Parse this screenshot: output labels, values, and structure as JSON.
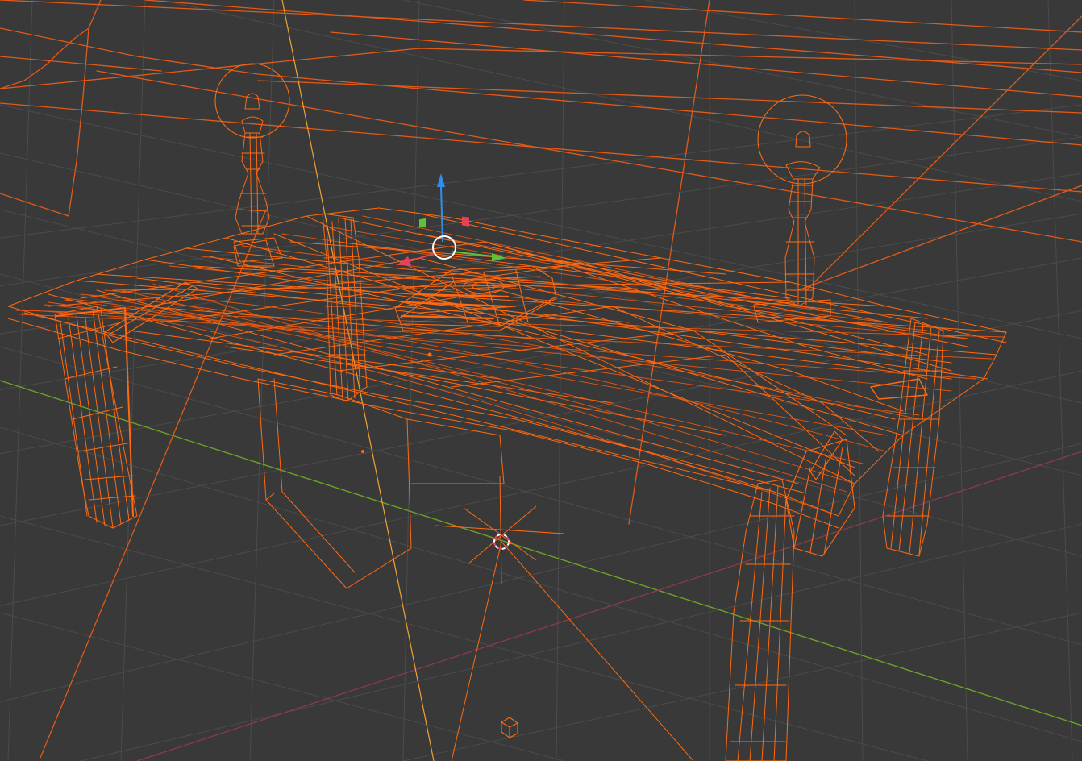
{
  "viewport": {
    "mode": "wireframe",
    "background_color": "#393939",
    "grid_color": "#4a4a4a",
    "axis_x_color": "#b3445a",
    "axis_y_color": "#6aa127",
    "selection_color": "#ff6a10",
    "selection_highlight_color": "#ff8a2a"
  },
  "gizmo": {
    "z_color": "#2f8ef0",
    "y_color": "#5cc33a",
    "x_color": "#e4415a",
    "center_color": "#ffffff"
  },
  "icons": [
    "3d-cursor-icon",
    "light-object-icon",
    "transform-gizmo-icon"
  ]
}
